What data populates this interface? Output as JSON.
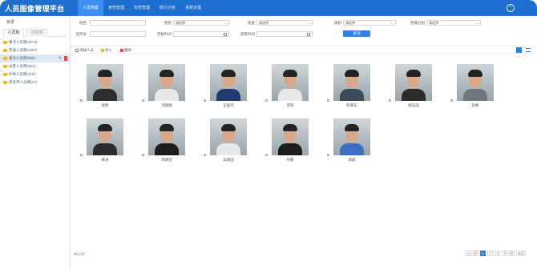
{
  "header": {
    "app_title": "人员图像管理平台",
    "nav": [
      "人员档案",
      "身份管理",
      "布控管理",
      "统计分析",
      "系统设置"
    ],
    "user_icon": "user-circle-icon"
  },
  "sidebar": {
    "title": "目录",
    "tabs": [
      "人员库",
      "识别库"
    ],
    "items": [
      "重点人员库(3274)",
      "普通人员库(1207)",
      "重点人员库(895)",
      "访客人员库(462)",
      "外来人员库(318)",
      "黑名单人员库(27)"
    ]
  },
  "filters": {
    "name_label": "姓名",
    "name_value": "",
    "gender_label": "性别",
    "gender_value": "请选择",
    "nation_label": "民族",
    "nation_value": "请选择",
    "type_label": "类别",
    "type_value": "请选择",
    "status_label": "所属分组",
    "status_value": "请选择",
    "id_label": "证件号",
    "id_value": "",
    "start_label": "开始时间",
    "start_value": "",
    "end_label": "结束时间",
    "end_value": "",
    "query_button": "查询"
  },
  "toolbar": {
    "add_label": "添加人员",
    "import_label": "导入",
    "delete_label": "删除"
  },
  "people": [
    {
      "name": "张伟"
    },
    {
      "name": "刘丽娟"
    },
    {
      "name": "王俊杰"
    },
    {
      "name": "李阳"
    },
    {
      "name": "陈晓东"
    },
    {
      "name": "杨志强"
    },
    {
      "name": "赵敏"
    },
    {
      "name": "黄涛"
    },
    {
      "name": "周明亮"
    },
    {
      "name": "吴建国"
    },
    {
      "name": "孙鹏"
    },
    {
      "name": "郑斌"
    }
  ],
  "footer": {
    "total": "共12条",
    "pages": [
      "上一页",
      "1",
      "2",
      "3",
      "下一页",
      "末页"
    ],
    "active_page": "1"
  },
  "colors": {
    "brand": "#1e6fd0",
    "accent": "#2f80e7",
    "folder": "#f1b82c",
    "delete": "#e64545"
  }
}
